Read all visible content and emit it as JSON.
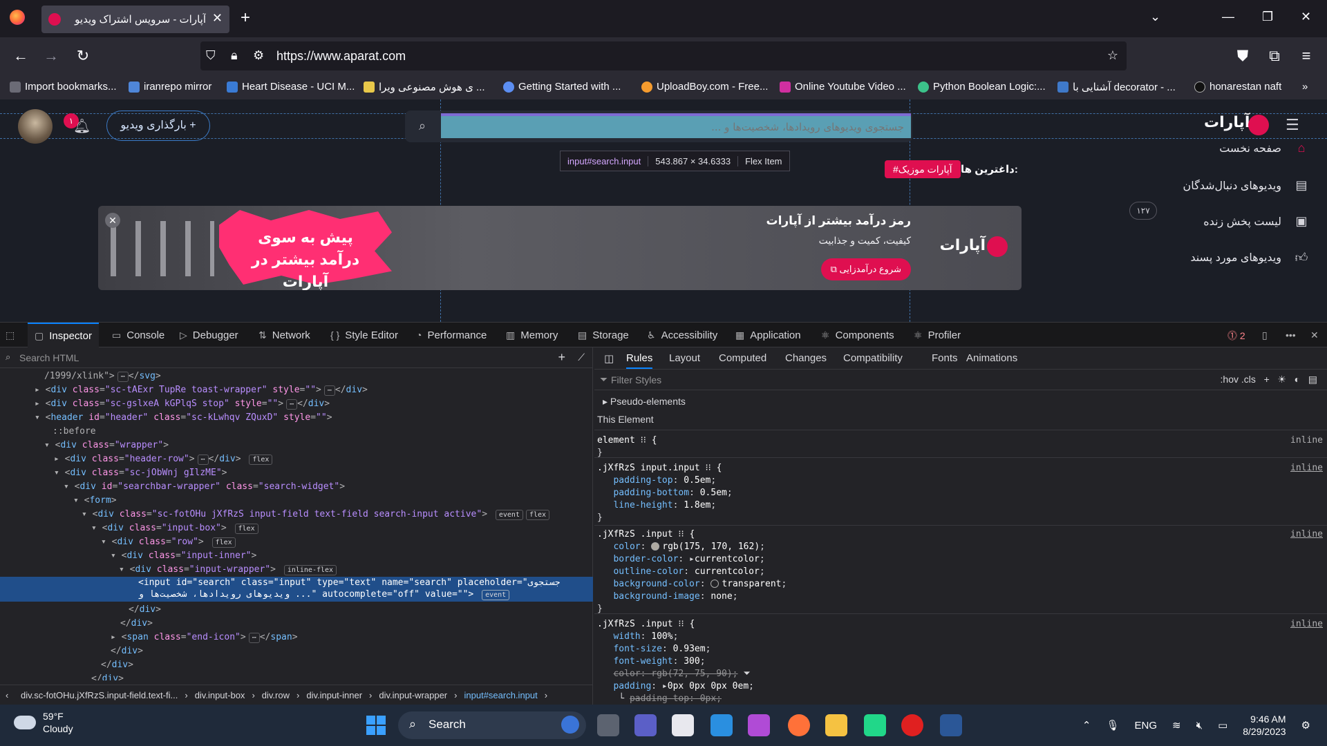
{
  "browser": {
    "tab_title": "آپارات - سرویس اشتراک ویدیو",
    "url": "https://www.aparat.com",
    "bookmarks": [
      "Import bookmarks...",
      "iranrepo mirror",
      "Heart Disease - UCI M...",
      "ی هوش مصنوعی ویرا ...",
      "Getting Started with ...",
      "UploadBoy.com - Free...",
      "Online Youtube Video ...",
      "Python Boolean Logic:...",
      "آشنایی با decorator - ...",
      "honarestan naft"
    ]
  },
  "page": {
    "notif_count": "۱",
    "upload_label": "بارگذاری ویدیو",
    "search_placeholder": "جستجوی ویدیوهای رویدادها، شخصیت‌ها و ...",
    "tooltip": {
      "selector": "input#search.input",
      "size": "543.867 × 34.6333",
      "type": "Flex Item"
    },
    "logo": "آپارات",
    "hot_label": "داغترین ها:",
    "hot_tag": "#آپارات موزیک",
    "sidebar": [
      {
        "label": "صفحه نخست",
        "icon": "home-icon"
      },
      {
        "label": "ویدیوهای دنبال‌شدگان",
        "icon": "subscriptions-icon"
      },
      {
        "label": "لیست پخش زنده",
        "icon": "live-icon"
      },
      {
        "label": "ویدیوهای مورد پسند",
        "icon": "like-icon"
      }
    ],
    "live_count": "۱۲۷",
    "banner": {
      "burst_text": "پیش به سوی درآمد بیشتر در آپارات",
      "headline": "رمز درآمد بیشتر از آپارات",
      "subline": "کیفیت، کمیت و جذابیت",
      "cta": "شروع درآمدزایی",
      "brand": "آپارات"
    }
  },
  "devtools": {
    "tabs": [
      "Inspector",
      "Console",
      "Debugger",
      "Network",
      "Style Editor",
      "Performance",
      "Memory",
      "Storage",
      "Accessibility",
      "Application",
      "Components",
      "Profiler"
    ],
    "error_count": "2",
    "search_placeholder": "Search HTML",
    "breadcrumbs": [
      "div.sc-fotOHu.jXfRzS.input-field.text-fi...",
      "div.input-box",
      "div.row",
      "div.input-inner",
      "div.input-wrapper",
      "input#search.input"
    ],
    "rules_tabs": [
      "Rules",
      "Layout",
      "Computed",
      "Changes",
      "Compatibility",
      "Fonts",
      "Animations"
    ],
    "filter_placeholder": "Filter Styles",
    "filter_tools": ":hov  .cls",
    "pseudo_label": "Pseudo-elements",
    "this_element": "This Element"
  },
  "taskbar": {
    "temp": "59°F",
    "weather": "Cloudy",
    "search": "Search",
    "lang": "ENG",
    "time": "9:46 AM",
    "date": "8/29/2023"
  }
}
